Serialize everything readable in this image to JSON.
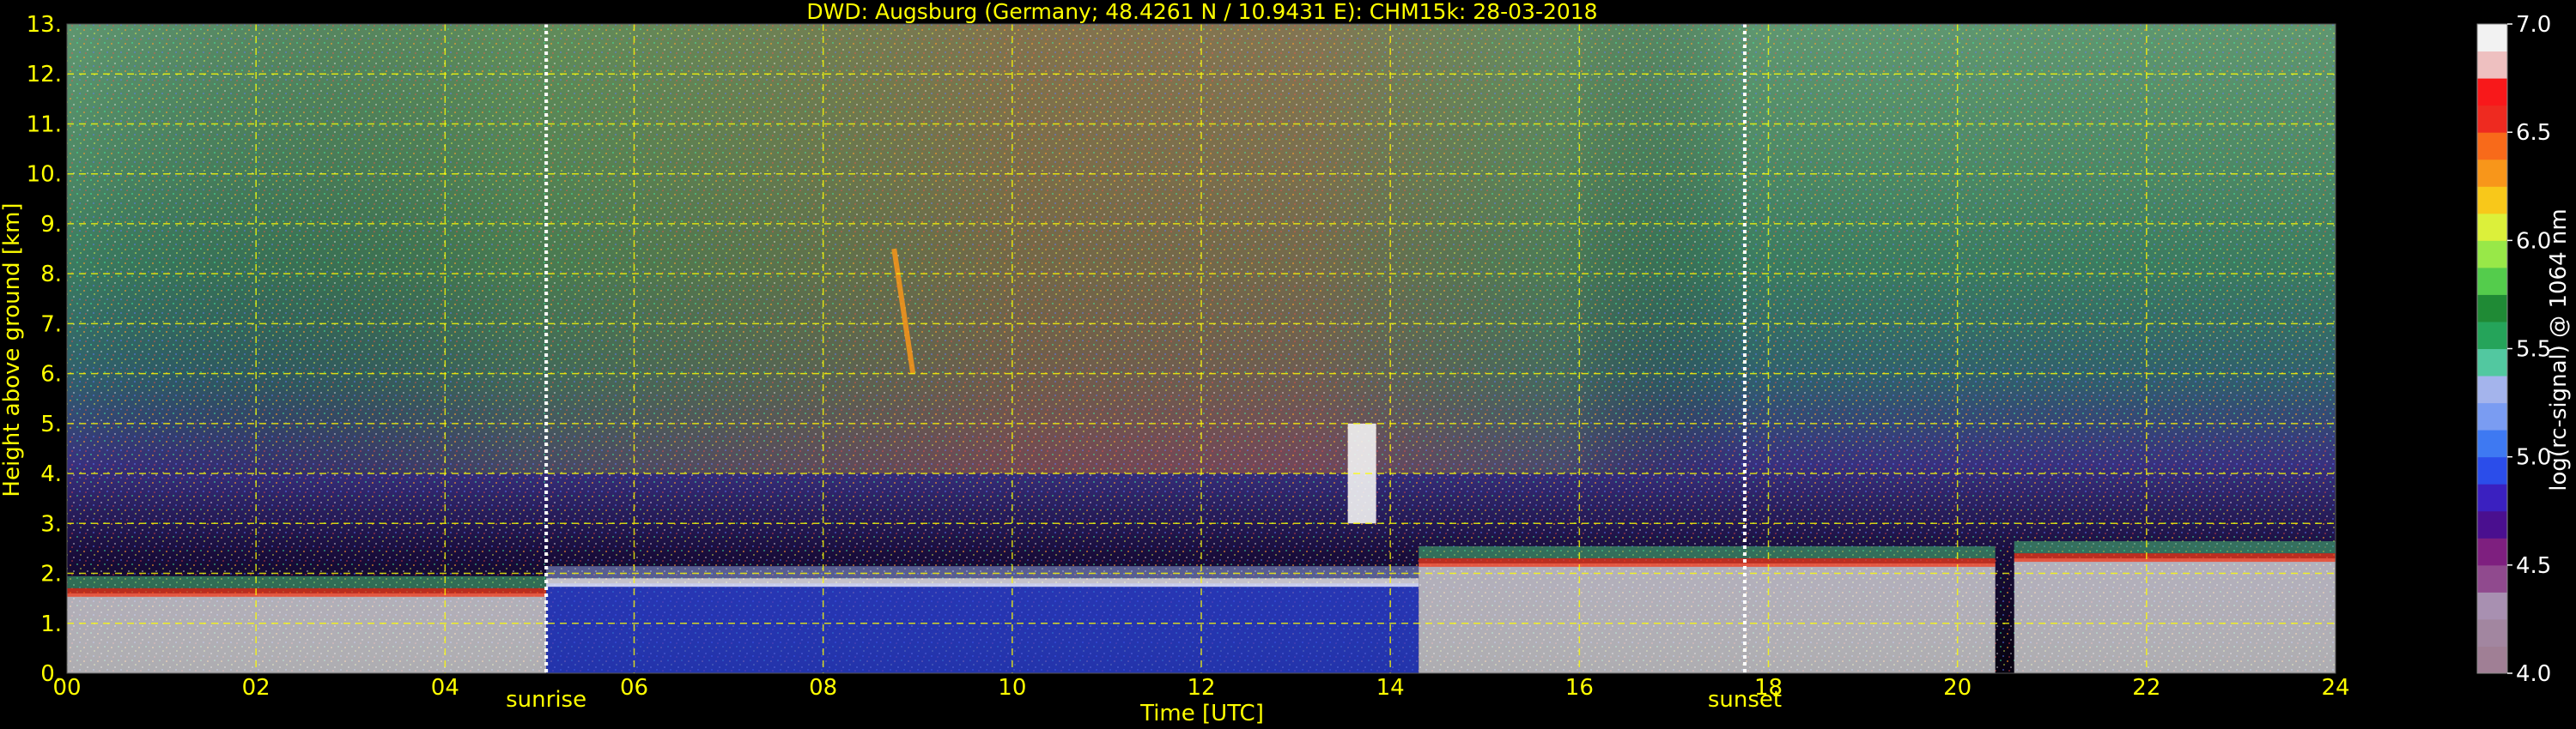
{
  "title": "DWD: Augsburg (Germany; 48.4261 N / 10.9431 E):    CHM15k: 28-03-2018",
  "colors": {
    "background": "#000000",
    "text": "#ffff00",
    "grid": "#ffff00",
    "colorbar_text": "#ffffff"
  },
  "chart_data": {
    "type": "heatmap",
    "title": "DWD: Augsburg (Germany; 48.4261 N / 10.9431 E):    CHM15k: 28-03-2018",
    "xlabel": "Time [UTC]",
    "ylabel": "Height above ground [km]",
    "xlim": [
      0,
      24
    ],
    "ylim": [
      0,
      13
    ],
    "x_ticks": [
      0,
      2,
      4,
      6,
      8,
      10,
      12,
      14,
      16,
      18,
      20,
      22,
      24
    ],
    "x_tick_labels": [
      "00",
      "02",
      "04",
      "06",
      "08",
      "10",
      "12",
      "14",
      "16",
      "18",
      "20",
      "22",
      "24"
    ],
    "y_ticks": [
      0,
      1,
      2,
      3,
      4,
      5,
      6,
      7,
      8,
      9,
      10,
      11,
      12,
      13
    ],
    "y_tick_labels": [
      "0.",
      "1.",
      "2.",
      "3.",
      "4.",
      "5.",
      "6.",
      "7.",
      "8.",
      "9.",
      "10.",
      "11.",
      "12.",
      "13."
    ],
    "grid": true,
    "vlines": [
      {
        "x": 5.07,
        "label": "sunrise"
      },
      {
        "x": 17.75,
        "label": "sunset"
      }
    ],
    "colorbar": {
      "label": "log(rc-signal) @ 1064 nm",
      "min": 4.0,
      "max": 7.0,
      "ticks": [
        4.0,
        4.5,
        5.0,
        5.5,
        6.0,
        6.5,
        7.0
      ],
      "tick_labels": [
        "4.0",
        "4.5",
        "5.0",
        "5.5",
        "6.0",
        "6.5",
        "7.0"
      ]
    },
    "features": [
      {
        "kind": "boundary_layer",
        "x_range": [
          0,
          5.07
        ],
        "top_km": 1.6,
        "level": 6.9
      },
      {
        "kind": "aerosol_layer",
        "x_range": [
          5.07,
          14.3
        ],
        "top_km": 1.8,
        "level": 5.0
      },
      {
        "kind": "boundary_layer",
        "x_range": [
          14.3,
          20.4
        ],
        "top_km": 2.2,
        "level": 6.9
      },
      {
        "kind": "boundary_layer",
        "x_range": [
          20.6,
          24
        ],
        "top_km": 2.3,
        "level": 6.9
      },
      {
        "kind": "cirrus_streak",
        "x": 8.9,
        "bottom_km": 6.0,
        "top_km": 8.5,
        "level": 6.3
      },
      {
        "kind": "cloud",
        "x": 13.7,
        "bottom_km": 3.0,
        "top_km": 5.0,
        "level": 7.0
      }
    ]
  }
}
